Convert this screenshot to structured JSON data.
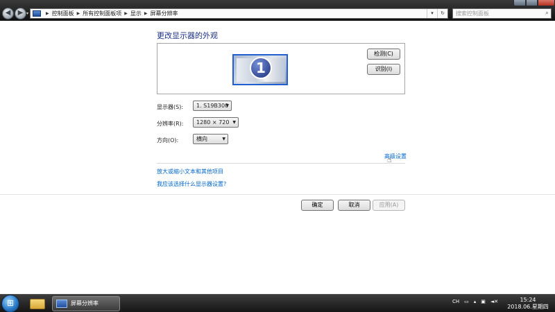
{
  "window": {
    "breadcrumb": [
      "控制面板",
      "所有控制面板项",
      "显示",
      "屏幕分辨率"
    ],
    "search_placeholder": "搜索控制面板"
  },
  "page": {
    "heading": "更改显示器的外观",
    "monitor_number": "1",
    "detect_button": "检测(C)",
    "identify_button": "识别(I)",
    "display_label": "显示器(S):",
    "display_value": "1. S19B300",
    "resolution_label": "分辨率(R):",
    "resolution_value": "1280 × 720",
    "orientation_label": "方向(O):",
    "orientation_value": "横向",
    "advanced_link": "高级设置",
    "link_text_size": "放大或缩小文本和其他项目",
    "link_which_settings": "我应该选择什么显示器设置?",
    "ok_button": "确定",
    "cancel_button": "取消",
    "apply_button": "应用(A)"
  },
  "taskbar": {
    "active_task": "屏幕分辨率",
    "tray_lang": "CH",
    "time": "15:24",
    "date": "2018.06.星期四"
  },
  "colors": {
    "heading": "#1e3287",
    "link": "#0066cc",
    "titlebar": "#1a1a1a"
  }
}
